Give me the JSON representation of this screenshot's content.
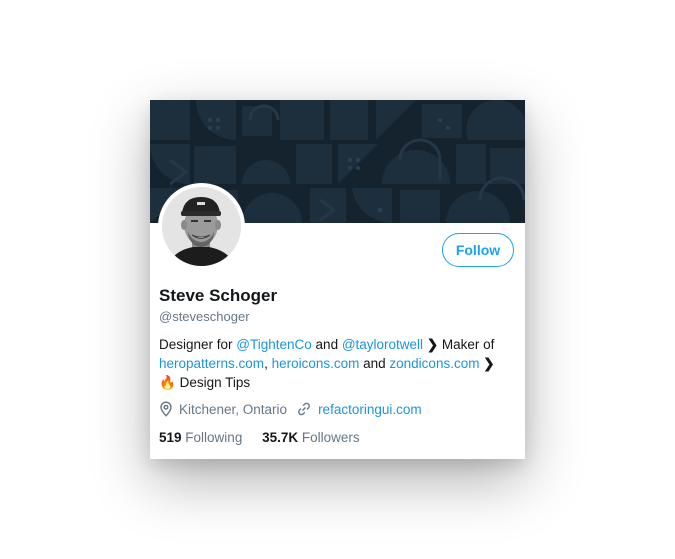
{
  "profile": {
    "name": "Steve Schoger",
    "handle": "@steveschoger",
    "follow_label": "Follow",
    "bio": {
      "part1": "Designer for ",
      "link1": "@TightenCo",
      "part2": " and ",
      "link2": "@taylorotwell",
      "chevron": "❯",
      "part3": " Maker of",
      "link3": "heropatterns.com",
      "part4": ", ",
      "link4": "heroicons.com",
      "part5": " and ",
      "link5": "zondicons.com",
      "emoji": "🔥",
      "part6": " Design Tips"
    },
    "location": "Kitchener, Ontario",
    "website": "refactoringui.com",
    "following_count": "519",
    "following_label": "Following",
    "followers_count": "35.7K",
    "followers_label": "Followers"
  },
  "icons": {
    "location": "map-pin-icon",
    "website": "link-icon"
  },
  "colors": {
    "accent": "#1da1f2",
    "banner": "#15232f",
    "text": "#14171a",
    "muted": "#657786"
  }
}
